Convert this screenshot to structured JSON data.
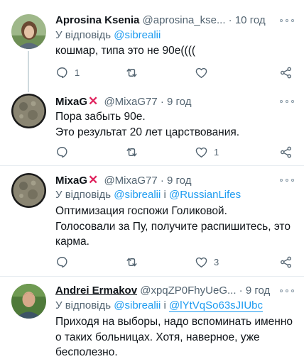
{
  "tweets": [
    {
      "name": "Aprosina Ksenia",
      "handle": "@aprosina_kse...",
      "time": "10 год",
      "reply_prefix": "У відповідь",
      "reply_to": [
        "@sibrealii"
      ],
      "text": [
        "кошмар, типа это не 90е(((("
      ],
      "stats": {
        "replies": "1",
        "retweets": "",
        "likes": ""
      }
    },
    {
      "name": "MixaG",
      "handle": "@MixaG77",
      "time": "9 год",
      "text": [
        "Пора забыть 90е.",
        "Это результат 20 лет царствования."
      ],
      "stats": {
        "replies": "",
        "retweets": "",
        "likes": "1"
      }
    },
    {
      "name": "MixaG",
      "handle": "@MixaG77",
      "time": "9 год",
      "reply_prefix": "У відповідь",
      "reply_to": [
        "@sibrealii",
        "@RussianLifes"
      ],
      "reply_join": "і",
      "text": [
        "Оптимизация госпожи Голиковой.",
        "Голосовали за Пу, получите распишитесь, это",
        "карма."
      ],
      "stats": {
        "replies": "",
        "retweets": "",
        "likes": "3"
      }
    },
    {
      "name": "Andrei Ermakov",
      "handle": "@xpqZP0FhyUeG...",
      "time": "9 год",
      "reply_prefix": "У відповідь",
      "reply_to": [
        "@sibrealii",
        "@lYtVqSo63sJIUbc"
      ],
      "reply_join": "і",
      "text": [
        "Приходя на выборы, надо вспоминать именно",
        "о таких больницах. Хотя, наверное, уже",
        "бесполезно."
      ]
    }
  ],
  "separator": "·",
  "colors": {
    "accent": "#1d9bf0",
    "x_mark": "#e0245e",
    "muted": "#536471"
  },
  "icons": [
    "reply-icon",
    "retweet-icon",
    "like-icon",
    "share-icon",
    "more-icon",
    "x-mark-icon"
  ]
}
